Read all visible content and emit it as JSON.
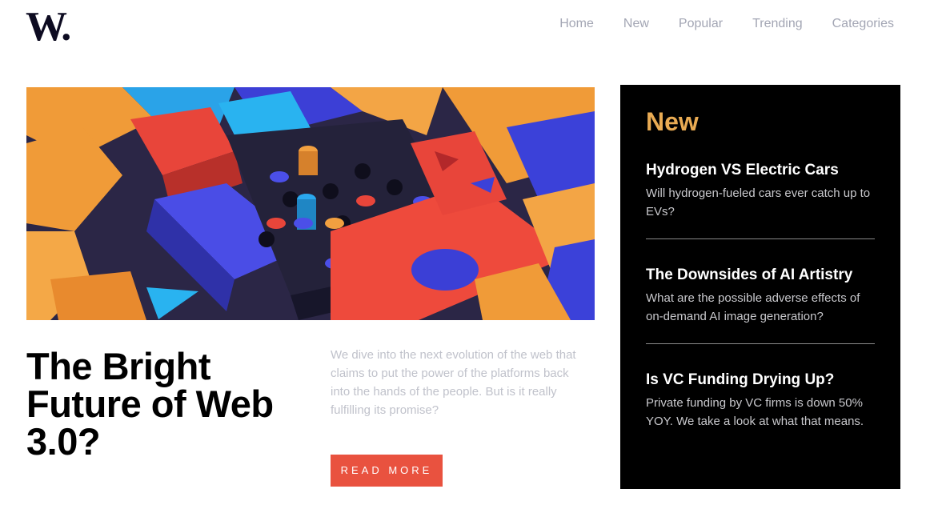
{
  "header": {
    "logo": {
      "letter": "W",
      "dot": "."
    },
    "nav": [
      "Home",
      "New",
      "Popular",
      "Trending",
      "Categories"
    ]
  },
  "hero": {
    "image_icon": "abstract-3d-blocks-image",
    "headline": "The Bright Future of Web 3.0?",
    "summary": "We dive into the next evolution of the web that claims to put the power of the platforms back into the hands of the people. But is it really fulfilling its promise?",
    "cta_label": "READ MORE"
  },
  "new_panel": {
    "title": "New",
    "items": [
      {
        "title": "Hydrogen VS Electric Cars",
        "desc": "Will hydrogen-fueled cars ever catch up to EVs?"
      },
      {
        "title": "The Downsides of AI Artistry",
        "desc": "What are the possible adverse effects of on-demand AI image generation?"
      },
      {
        "title": "Is VC Funding Drying Up?",
        "desc": "Private funding by VC firms is down 50% YOY. We take a look at what that means."
      }
    ]
  },
  "colors": {
    "accent_orange": "#e9ab53",
    "cta_red": "#e9523f",
    "nav_gray": "#a3a6b4",
    "logo_navy": "#0d0b21"
  }
}
